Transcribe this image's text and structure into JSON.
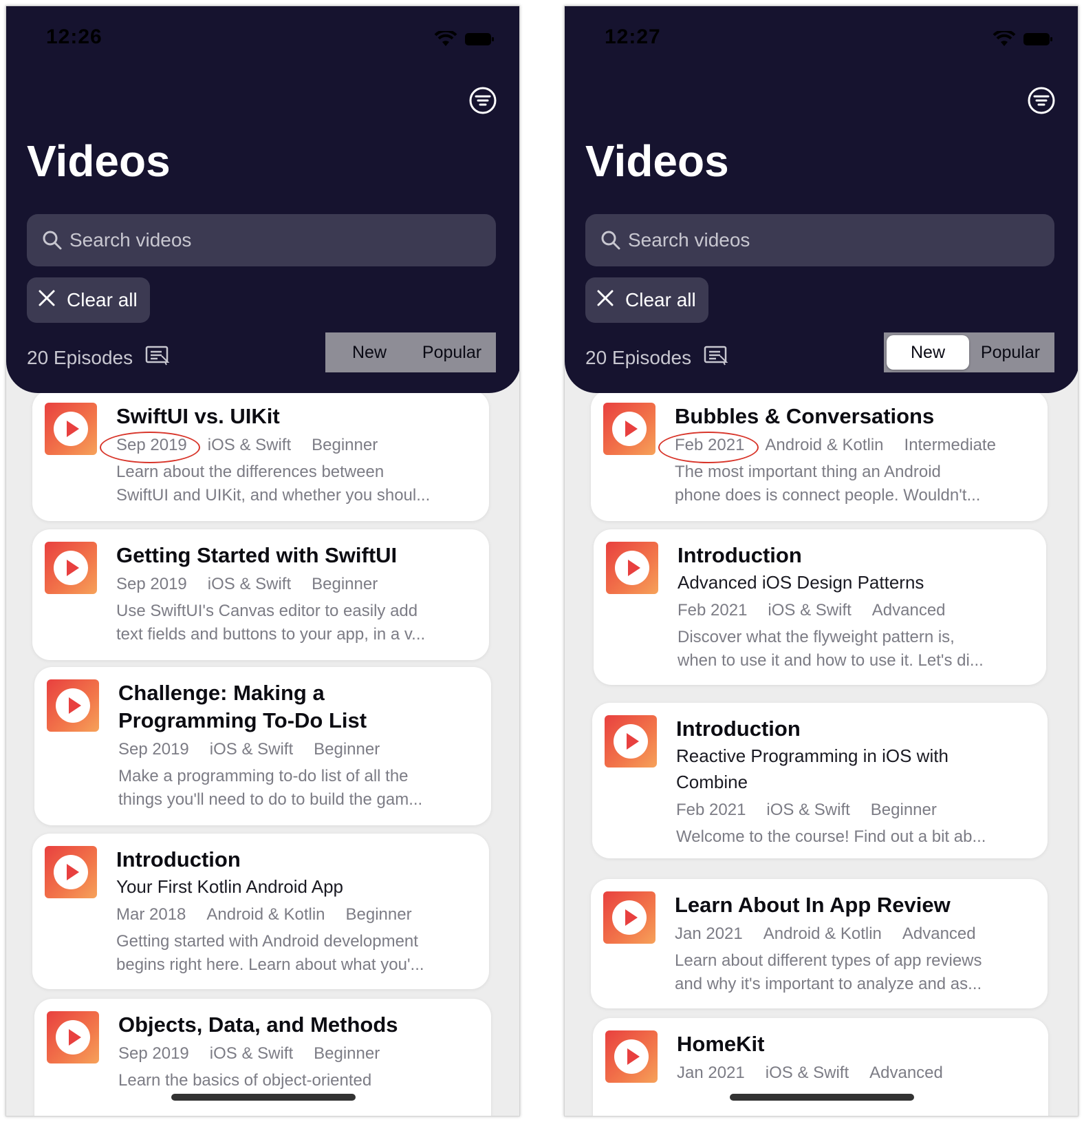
{
  "screens": [
    {
      "status_time": "12:26",
      "title": "Videos",
      "search_placeholder": "Search videos",
      "clear_label": "Clear all",
      "episodes_label": "20 Episodes",
      "segments": [
        "New",
        "Popular"
      ],
      "selected_segment": null,
      "videos": [
        {
          "title": "SwiftUI vs. UIKit",
          "subtitle": "",
          "date": "Sep 2019",
          "domain": "iOS & Swift",
          "level": "Beginner",
          "desc_line1": "Learn about the differences between",
          "desc_line2": "SwiftUI and UIKit, and whether you shoul..."
        },
        {
          "title": "Getting Started with SwiftUI",
          "subtitle": "",
          "date": "Sep 2019",
          "domain": "iOS & Swift",
          "level": "Beginner",
          "desc_line1": "Use SwiftUI's Canvas editor to easily add",
          "desc_line2": "text fields and buttons to your app, in a v..."
        },
        {
          "title": "Challenge: Making a",
          "title_line2": "Programming To-Do List",
          "subtitle": "",
          "date": "Sep 2019",
          "domain": "iOS & Swift",
          "level": "Beginner",
          "desc_line1": "Make a programming to-do list of all the",
          "desc_line2": "things you'll need to do to build the gam..."
        },
        {
          "title": "Introduction",
          "subtitle": "Your First Kotlin Android App",
          "date": "Mar 2018",
          "domain": "Android & Kotlin",
          "level": "Beginner",
          "desc_line1": "Getting started with Android development",
          "desc_line2": "begins right here. Learn about what you'..."
        },
        {
          "title": "Objects, Data, and Methods",
          "subtitle": "",
          "date": "Sep 2019",
          "domain": "iOS & Swift",
          "level": "Beginner",
          "desc_line1": "Learn the basics of object-oriented",
          "desc_line2": ""
        }
      ]
    },
    {
      "status_time": "12:27",
      "title": "Videos",
      "search_placeholder": "Search videos",
      "clear_label": "Clear all",
      "episodes_label": "20 Episodes",
      "segments": [
        "New",
        "Popular"
      ],
      "selected_segment": "New",
      "videos": [
        {
          "title": "Bubbles & Conversations",
          "subtitle": "",
          "date": "Feb 2021",
          "domain": "Android & Kotlin",
          "level": "Intermediate",
          "desc_line1": "The most important thing an Android",
          "desc_line2": "phone does is connect people. Wouldn't..."
        },
        {
          "title": "Introduction",
          "subtitle": "Advanced iOS Design Patterns",
          "date": "Feb 2021",
          "domain": "iOS & Swift",
          "level": "Advanced",
          "desc_line1": "Discover what the flyweight pattern is,",
          "desc_line2": "when to use it and how to use it. Let's di..."
        },
        {
          "title": "Introduction",
          "subtitle": "Reactive Programming in iOS with",
          "subtitle_line2": "Combine",
          "date": "Feb 2021",
          "domain": "iOS & Swift",
          "level": "Beginner",
          "desc_line1": "Welcome to the course! Find out a bit ab...",
          "desc_line2": ""
        },
        {
          "title": "Learn About In App Review",
          "subtitle": "",
          "date": "Jan 2021",
          "domain": "Android & Kotlin",
          "level": "Advanced",
          "desc_line1": "Learn about different types of app reviews",
          "desc_line2": "and why it's important to analyze and as..."
        },
        {
          "title": "HomeKit",
          "subtitle": "",
          "date": "Jan 2021",
          "domain": "iOS & Swift",
          "level": "Advanced",
          "desc_line1": "",
          "desc_line2": ""
        }
      ]
    }
  ],
  "colors": {
    "header": "#16132f",
    "accent": "#e8403f",
    "highlight_circle": "#d8352a"
  },
  "icons": [
    "wifi-icon",
    "battery-icon",
    "filter-icon",
    "search-icon",
    "close-icon",
    "episodes-list-icon",
    "play-icon"
  ]
}
